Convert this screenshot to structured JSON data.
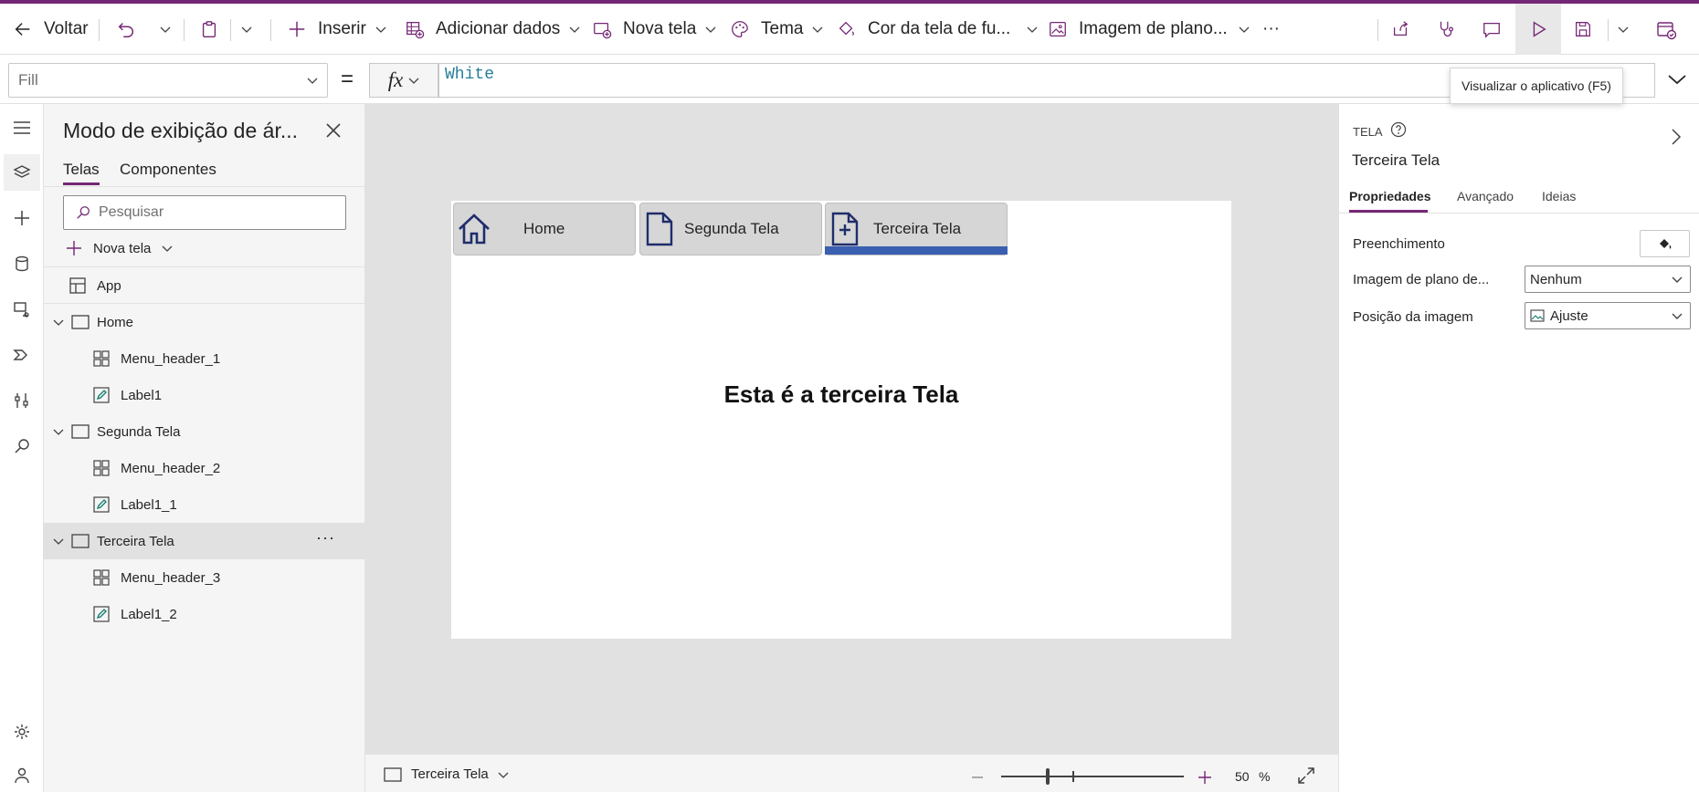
{
  "toolbar": {
    "back_label": "Voltar",
    "insert_label": "Inserir",
    "add_data_label": "Adicionar dados",
    "new_screen_label": "Nova tela",
    "theme_label": "Tema",
    "bg_color_label": "Cor da tela de fu...",
    "bg_image_label": "Imagem de plano...",
    "more_label": "···"
  },
  "formula_bar": {
    "property": "Fill",
    "equals": "=",
    "fx_label": "fx",
    "formula": "White"
  },
  "tooltip": "Visualizar o aplicativo (F5)",
  "tree_panel": {
    "title": "Modo de exibição de ár...",
    "tabs": [
      "Telas",
      "Componentes"
    ],
    "search_placeholder": "Pesquisar",
    "new_screen_label": "Nova tela",
    "app_label": "App",
    "more_dots": "···",
    "screens": [
      {
        "name": "Home",
        "children": [
          "Menu_header_1",
          "Label1"
        ]
      },
      {
        "name": "Segunda Tela",
        "children": [
          "Menu_header_2",
          "Label1_1"
        ]
      },
      {
        "name": "Terceira Tela",
        "children": [
          "Menu_header_3",
          "Label1_2"
        ]
      }
    ],
    "selected_screen": "Terceira Tela"
  },
  "canvas": {
    "nav_buttons": [
      "Home",
      "Segunda Tela",
      "Terceira Tela"
    ],
    "active_nav": "Terceira Tela",
    "label_text": "Esta é a terceira Tela",
    "active_color": "#3a5fb0"
  },
  "status_bar": {
    "screen_name": "Terceira Tela",
    "zoom_value": "50",
    "zoom_unit": "%"
  },
  "props_panel": {
    "section_label": "TELA",
    "screen_name": "Terceira Tela",
    "tabs": [
      "Propriedades",
      "Avançado",
      "Ideias"
    ],
    "fill_label": "Preenchimento",
    "bg_image_label": "Imagem de plano de...",
    "bg_image_value": "Nenhum",
    "image_position_label": "Posição da imagem",
    "image_position_value": "Ajuste"
  },
  "colors": {
    "brand": "#742774",
    "accent": "#3a5fb0"
  }
}
